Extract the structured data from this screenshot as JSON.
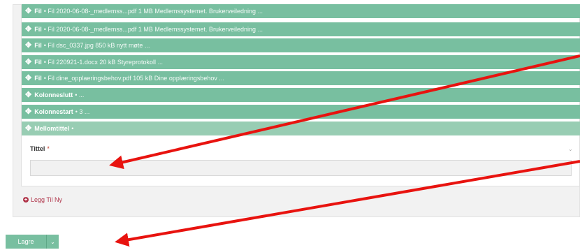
{
  "colors": {
    "bar": "#78bfa0",
    "bar_active": "#98cdb3",
    "arrow": "#e8130f",
    "link": "#b0354a"
  },
  "rows": [
    {
      "type": "Fil",
      "desc": "• Fil 2020-06-08-_medlemss...pdf 1 MB Medlemssystemet. Brukerveiledning ..."
    },
    {
      "type": "Fil",
      "desc": "• Fil 2020-06-08-_medlemss...pdf 1 MB Medlemssystemet. Brukerveiledning ..."
    },
    {
      "type": "Fil",
      "desc": "• Fil dsc_0337.jpg 850 kB nytt møte ..."
    },
    {
      "type": "Fil",
      "desc": "• Fil 220921-1.docx 20 kB Styreprotokoll ..."
    },
    {
      "type": "Fil",
      "desc": "• Fil dine_opplaeringsbehov.pdf 105 kB Dine opplæringsbehov ..."
    },
    {
      "type": "Kolonneslutt",
      "desc": "• ..."
    },
    {
      "type": "Kolonnestart",
      "desc": "• 3 ..."
    },
    {
      "type": "Mellomtittel",
      "desc": "•"
    }
  ],
  "icons": {
    "move": "move-icon",
    "add": "plus-circle-icon",
    "caret": "chevron-down-icon"
  },
  "form": {
    "title_label": "Tittel",
    "required_mark": "*",
    "title_value": ""
  },
  "add_new_label": "Legg Til Ny",
  "save": {
    "label": "Lagre"
  }
}
